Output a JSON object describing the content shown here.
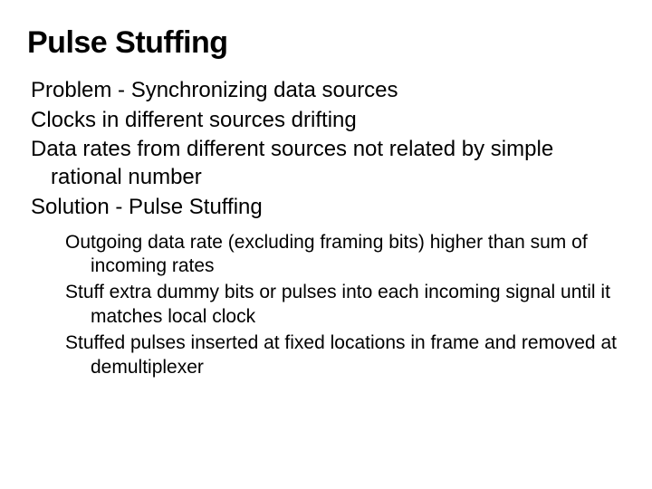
{
  "title": "Pulse Stuffing",
  "top": {
    "p1": "Problem - Synchronizing data sources",
    "p2": "Clocks in different sources drifting",
    "p3": "Data rates from different sources not related by simple rational number",
    "p4": "Solution - Pulse Stuffing"
  },
  "sub": {
    "s1": "Outgoing data rate (excluding framing bits) higher than sum of incoming rates",
    "s2": "Stuff extra dummy bits or pulses into each incoming signal until it matches local clock",
    "s3": "Stuffed pulses inserted at fixed locations in frame and removed at demultiplexer"
  }
}
